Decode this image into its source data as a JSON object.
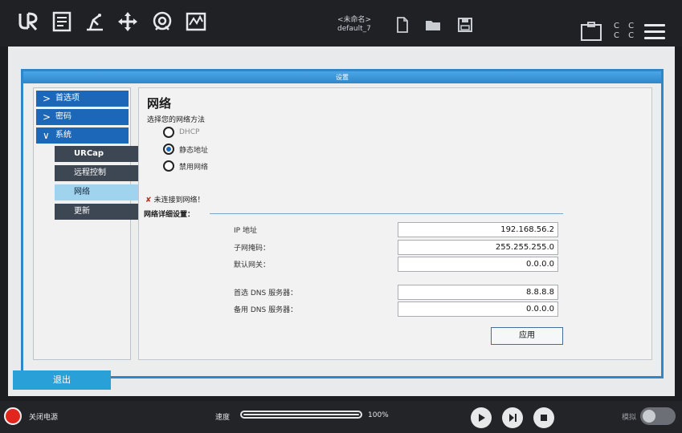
{
  "header": {
    "program_name_placeholder": "<未命名>",
    "program_name": "default_7",
    "icons": [
      "ur-logo-icon",
      "program-icon",
      "installation-icon",
      "move-icon",
      "io-icon",
      "log-icon",
      "new-file-icon",
      "open-folder-icon",
      "save-icon",
      "clipboard-icon",
      "menu-icon"
    ],
    "cc_text_top": "C C",
    "cc_text_bottom": "C C"
  },
  "window": {
    "title": "设置"
  },
  "sidebar": {
    "items": [
      {
        "label": "首选项",
        "chevron": ">"
      },
      {
        "label": "密码",
        "chevron": ">"
      },
      {
        "label": "系统",
        "chevron": "∨"
      }
    ],
    "subitems": [
      {
        "label": "URCap"
      },
      {
        "label": "远程控制"
      },
      {
        "label": "网络",
        "active": true
      },
      {
        "label": "更新"
      }
    ],
    "exit_label": "退出"
  },
  "network": {
    "title": "网络",
    "subtitle": "选择您的网络方法",
    "options": [
      {
        "label": "DHCP",
        "selected": false,
        "disabled": true
      },
      {
        "label": "静态地址",
        "selected": true,
        "disabled": false
      },
      {
        "label": "禁用网络",
        "selected": false,
        "disabled": false
      }
    ],
    "status": "未连接到网络！",
    "details_title": "网络详细设置：",
    "fields": [
      {
        "label": "IP 地址",
        "value": "192.168.56.2"
      },
      {
        "label": "子网掩码：",
        "value": "255.255.255.0"
      },
      {
        "label": "默认网关：",
        "value": "0.0.0.0"
      },
      {
        "label": "首选 DNS 服务器：",
        "value": "8.8.8.8"
      },
      {
        "label": "备用 DNS 服务器：",
        "value": "0.0.0.0"
      }
    ],
    "apply_label": "应用"
  },
  "footer": {
    "power_label": "关闭电源",
    "speed_label": "速度",
    "speed_value": "100%",
    "speed_fraction": 1.0,
    "sim_label": "模拟"
  },
  "colors": {
    "accent": "#1c67b8",
    "window_border": "#2f86c8",
    "active_sub": "#9fd3ee",
    "power": "#e3261d"
  }
}
